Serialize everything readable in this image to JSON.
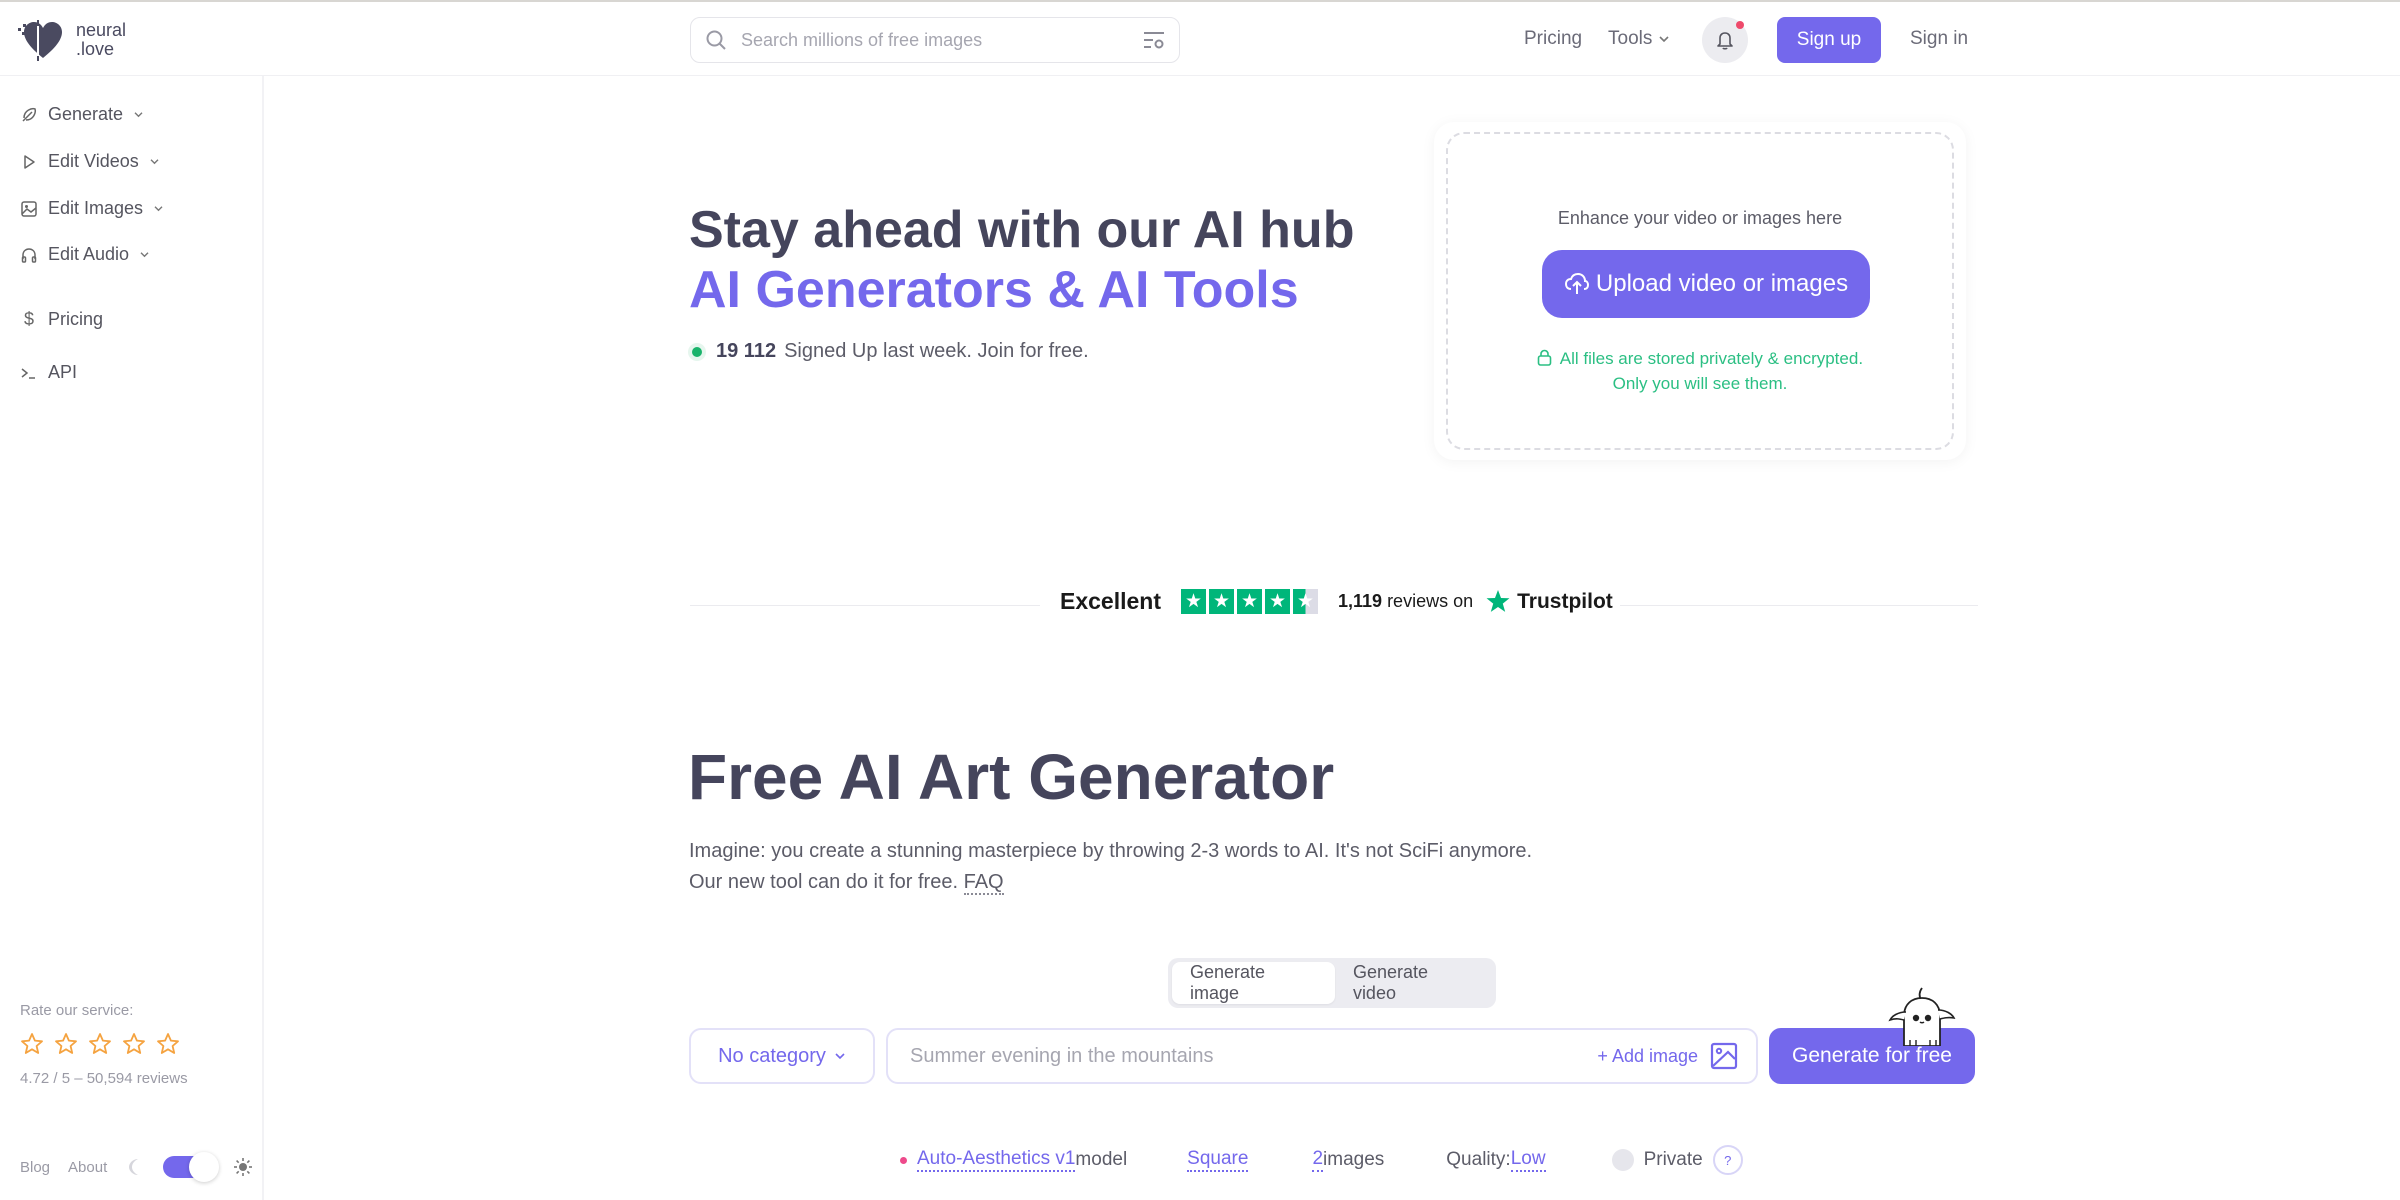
{
  "header": {
    "logo_line1": "neural",
    "logo_line2": ".love",
    "search_placeholder": "Search millions of free images",
    "nav": {
      "pricing": "Pricing",
      "tools": "Tools"
    },
    "signup": "Sign up",
    "signin": "Sign in"
  },
  "sidebar": {
    "items": [
      {
        "label": "Generate",
        "icon": "feather-icon",
        "has_dropdown": true
      },
      {
        "label": "Edit Videos",
        "icon": "play-icon",
        "has_dropdown": true
      },
      {
        "label": "Edit Images",
        "icon": "image-icon",
        "has_dropdown": true
      },
      {
        "label": "Edit Audio",
        "icon": "headphones-icon",
        "has_dropdown": true
      },
      {
        "label": "Pricing",
        "icon": "dollar-icon",
        "has_dropdown": false
      },
      {
        "label": "API",
        "icon": "terminal-icon",
        "has_dropdown": false
      }
    ],
    "rate_label": "Rate our service:",
    "rating_summary": "4.72 / 5 – 50,594 reviews",
    "footer": {
      "blog": "Blog",
      "about": "About"
    },
    "theme": "light"
  },
  "hero": {
    "title": "Stay ahead with our AI hub",
    "subtitle": "AI Generators & AI Tools",
    "signed_count": "19 112",
    "signed_text": " Signed Up last week. Join for free."
  },
  "upload": {
    "heading": "Enhance your video or images here",
    "button": "Upload video or images",
    "privacy_line1": "All files are stored privately & encrypted.",
    "privacy_line2": "Only you will see them."
  },
  "trustpilot": {
    "rating_word": "Excellent",
    "stars": 4.5,
    "reviews_count": "1,119",
    "reviews_suffix": " reviews on",
    "brand": "Trustpilot"
  },
  "generator": {
    "title": "Free AI Art Generator",
    "desc_line1": "Imagine: you create a stunning masterpiece by throwing 2-3 words to AI. It's not SciFi anymore.",
    "desc_line2": "Our new tool can do it for free. ",
    "faq": "FAQ",
    "tabs": [
      {
        "label": "Generate image",
        "active": true
      },
      {
        "label": "Generate video",
        "active": false
      }
    ],
    "category": "No category",
    "prompt_placeholder": "Summer evening in the mountains",
    "add_image": "+ Add image",
    "generate_button": "Generate for free",
    "options": {
      "model": "Auto-Aesthetics v1",
      "model_suffix": " model",
      "aspect": "Square",
      "count": "2",
      "count_suffix": " images",
      "quality_label": "Quality: ",
      "quality": "Low",
      "private_label": "Private",
      "help": "?"
    }
  },
  "colors": {
    "accent": "#7468ec",
    "success": "#2bbf83",
    "trustpilot_green": "#00b67a",
    "notification": "#ee4a6b",
    "star_outline": "#f5a340"
  }
}
